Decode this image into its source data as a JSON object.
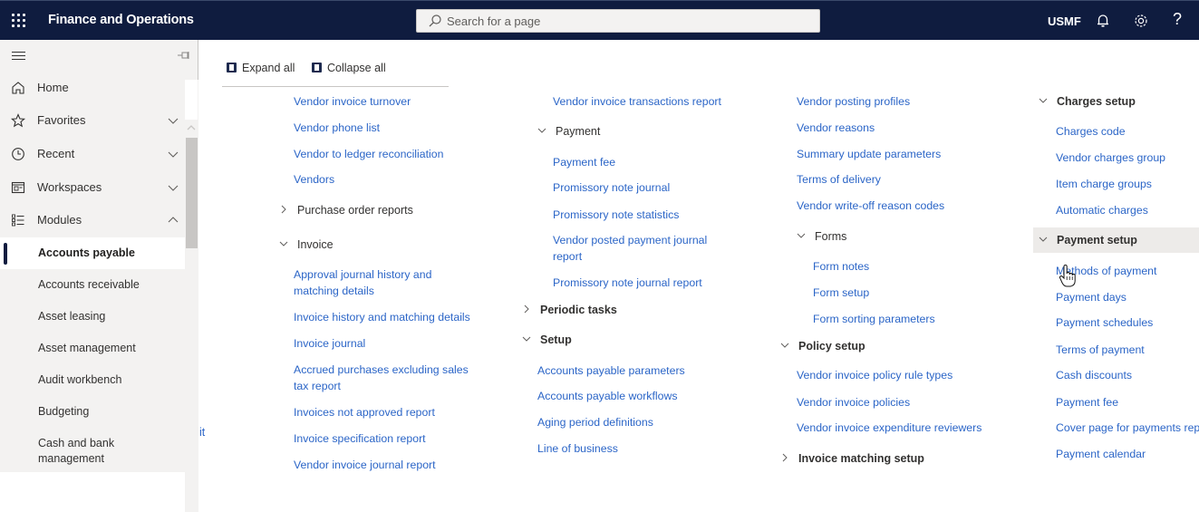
{
  "header": {
    "app_title": "Finance and Operations",
    "search_placeholder": "Search for a page",
    "company": "USMF",
    "help_label": "?",
    "icons": [
      "waffle-icon",
      "search-icon",
      "bell-icon",
      "gear-icon",
      "help-icon"
    ]
  },
  "nav": {
    "items": [
      {
        "label": "Home",
        "icon": "home-icon",
        "chevron": ""
      },
      {
        "label": "Favorites",
        "icon": "star-icon",
        "chevron": "down"
      },
      {
        "label": "Recent",
        "icon": "clock-icon",
        "chevron": "down"
      },
      {
        "label": "Workspaces",
        "icon": "workspace-icon",
        "chevron": "down"
      },
      {
        "label": "Modules",
        "icon": "list-icon",
        "chevron": "up"
      }
    ],
    "modules": [
      {
        "label": "Accounts payable",
        "active": true
      },
      {
        "label": "Accounts receivable"
      },
      {
        "label": "Asset leasing"
      },
      {
        "label": "Asset management"
      },
      {
        "label": "Audit workbench"
      },
      {
        "label": "Budgeting"
      },
      {
        "label": "Cash and bank management"
      }
    ]
  },
  "toolbar": {
    "expand_all": "Expand all",
    "collapse_all": "Collapse all"
  },
  "stray_text": "it",
  "columns": {
    "col1": {
      "links_top": [
        "Vendor invoice turnover",
        "Vendor phone list",
        "Vendor to ledger reconciliation",
        "Vendors"
      ],
      "purchase_order_reports": "Purchase order reports",
      "invoice_group": "Invoice",
      "invoice_links": [
        "Approval journal history and matching details",
        "Invoice history and matching details",
        "Invoice journal",
        "Accrued purchases excluding sales tax report",
        "Invoices not approved report",
        "Invoice specification report",
        "Vendor invoice journal report"
      ]
    },
    "col2": {
      "link_top": "Vendor invoice transactions report",
      "payment_group": "Payment",
      "payment_links": [
        "Payment fee",
        "Promissory note journal",
        "Promissory note statistics",
        "Vendor posted payment journal report",
        "Promissory note journal report"
      ],
      "periodic_tasks": "Periodic tasks",
      "setup": "Setup",
      "setup_links": [
        "Accounts payable parameters",
        "Accounts payable workflows",
        "Aging period definitions",
        "Line of business"
      ]
    },
    "col3": {
      "links_top": [
        "Vendor posting profiles",
        "Vendor reasons",
        "Summary update parameters",
        "Terms of delivery",
        "Vendor write-off reason codes"
      ],
      "forms_group": "Forms",
      "forms_links": [
        "Form notes",
        "Form setup",
        "Form sorting parameters"
      ],
      "policy_setup": "Policy setup",
      "policy_links": [
        "Vendor invoice policy rule types",
        "Vendor invoice policies",
        "Vendor invoice expenditure reviewers"
      ],
      "invoice_matching_setup": "Invoice matching setup"
    },
    "col4": {
      "charges_setup": "Charges setup",
      "charges_links": [
        "Charges code",
        "Vendor charges group",
        "Item charge groups",
        "Automatic charges"
      ],
      "payment_setup": "Payment setup",
      "payment_setup_links": [
        "Methods of payment",
        "Payment days",
        "Payment schedules",
        "Terms of payment",
        "Cash discounts",
        "Payment fee",
        "Cover page for payments rep",
        "Payment calendar"
      ]
    }
  },
  "colors": {
    "header_bg": "#0f1c3f",
    "link": "#2b65c7",
    "nav_bg": "#f3f2f1",
    "highlight": "#edebe9"
  }
}
